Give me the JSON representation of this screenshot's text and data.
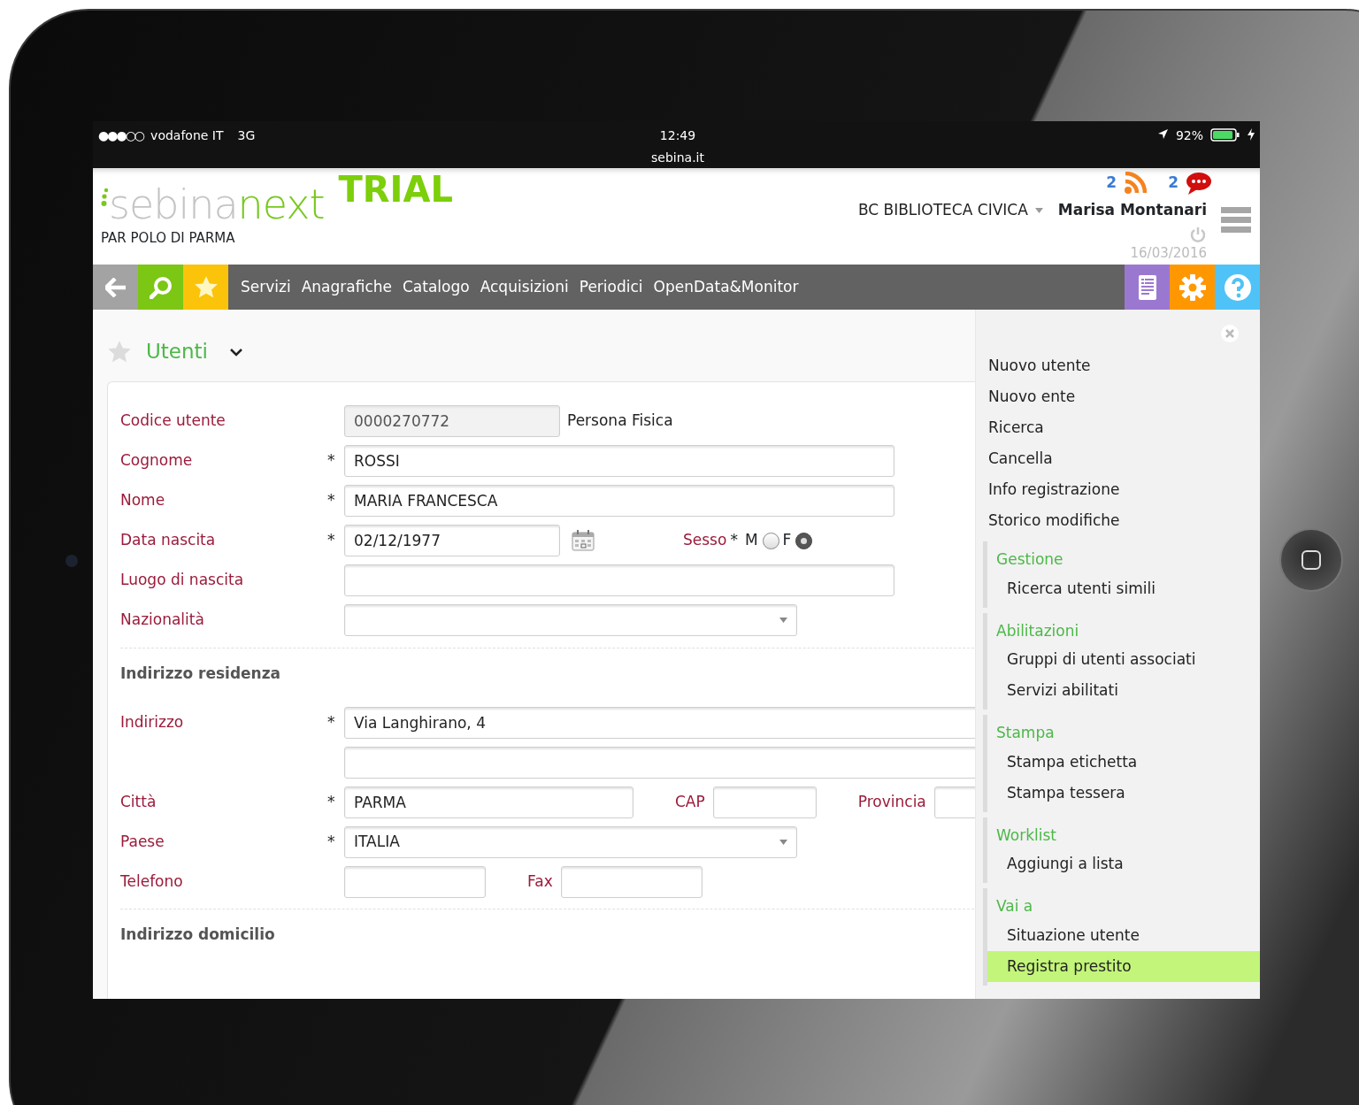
{
  "status_bar": {
    "signal": "●●●○○",
    "carrier": "vodafone IT",
    "network": "3G",
    "time": "12:49",
    "url": "sebina.it",
    "battery": "92%"
  },
  "header": {
    "logo": {
      "part_grey": "sebina",
      "part_green": "next"
    },
    "badge": "TRIAL",
    "subtitle": "PAR POLO DI PARMA",
    "feeds_count": "2",
    "messages_count": "2",
    "library": "BC BIBLIOTECA CIVICA",
    "user": "Marisa Montanari",
    "date": "16/03/2016"
  },
  "nav": {
    "items": [
      "Servizi",
      "Anagrafiche",
      "Catalogo",
      "Acquisizioni",
      "Periodici",
      "OpenData&Monitor"
    ]
  },
  "page": {
    "title": "Utenti",
    "favorite": false
  },
  "form": [
    {
      "kind": "row",
      "label": "Codice utente",
      "cells": [
        {
          "kind": "input",
          "value": "0000270772",
          "disabled": true
        },
        {
          "kind": "text",
          "text": "Persona Fisica"
        }
      ]
    },
    {
      "kind": "row",
      "label": "Cognome",
      "mark": "*",
      "cells": [
        {
          "kind": "input",
          "value": "ROSSI"
        }
      ]
    },
    {
      "kind": "row",
      "label": "Nome",
      "mark": "*",
      "cells": [
        {
          "kind": "input",
          "value": "MARIA FRANCESCA"
        }
      ]
    },
    {
      "kind": "row",
      "label": "Data nascita",
      "mark": "*",
      "cells": [
        {
          "kind": "input",
          "value": "02/12/1977"
        },
        {
          "kind": "calendar"
        },
        {
          "kind": "label",
          "text": "Sesso",
          "mark": "*"
        },
        {
          "kind": "radio",
          "text": "M",
          "selected": false
        },
        {
          "kind": "radio",
          "text": "F",
          "selected": true
        }
      ]
    },
    {
      "kind": "row",
      "label": "Luogo di nascita",
      "cells": [
        {
          "kind": "input"
        }
      ]
    },
    {
      "kind": "row",
      "label": "Nazionalità",
      "cells": [
        {
          "kind": "select"
        }
      ]
    },
    {
      "kind": "section",
      "title": "Indirizzo residenza"
    },
    {
      "kind": "row",
      "label": "Indirizzo",
      "mark": "*",
      "cells": [
        {
          "kind": "input",
          "value": "Via Langhirano, 4"
        }
      ]
    },
    {
      "kind": "row",
      "cells": [
        {
          "kind": "input"
        }
      ]
    },
    {
      "kind": "row",
      "label": "Città",
      "mark": "*",
      "cells": [
        {
          "kind": "input",
          "value": "PARMA"
        },
        {
          "kind": "label",
          "text": "CAP"
        },
        {
          "kind": "input"
        },
        {
          "kind": "label",
          "text": "Provincia"
        },
        {
          "kind": "input"
        }
      ]
    },
    {
      "kind": "row",
      "label": "Paese",
      "mark": "*",
      "cells": [
        {
          "kind": "select",
          "value": "ITALIA"
        }
      ]
    },
    {
      "kind": "row",
      "label": "Telefono",
      "cells": [
        {
          "kind": "input"
        },
        {
          "kind": "label",
          "text": "Fax"
        },
        {
          "kind": "input"
        }
      ]
    },
    {
      "kind": "section",
      "title": "Indirizzo domicilio"
    }
  ],
  "menu": [
    {
      "kind": "action",
      "label": "Nuovo utente",
      "selected": false
    },
    {
      "kind": "action",
      "label": "Nuovo ente",
      "selected": false
    },
    {
      "kind": "action",
      "label": "Ricerca",
      "selected": false
    },
    {
      "kind": "action",
      "label": "Cancella",
      "selected": false
    },
    {
      "kind": "action",
      "label": "Info registrazione",
      "selected": false
    },
    {
      "kind": "action",
      "label": "Storico modifiche",
      "selected": false
    },
    {
      "kind": "group",
      "title": "Gestione",
      "items": [
        {
          "label": "Ricerca utenti simili",
          "selected": false
        }
      ]
    },
    {
      "kind": "group",
      "title": "Abilitazioni",
      "items": [
        {
          "label": "Gruppi di utenti associati",
          "selected": false
        },
        {
          "label": "Servizi abilitati",
          "selected": false
        }
      ]
    },
    {
      "kind": "group",
      "title": "Stampa",
      "items": [
        {
          "label": "Stampa etichetta",
          "selected": false
        },
        {
          "label": "Stampa tessera",
          "selected": false
        }
      ]
    },
    {
      "kind": "group",
      "title": "Worklist",
      "items": [
        {
          "label": "Aggiungi a lista",
          "selected": false
        }
      ]
    },
    {
      "kind": "group",
      "title": "Vai a",
      "items": [
        {
          "label": "Situazione utente",
          "selected": false
        },
        {
          "label": "Registra prestito",
          "selected": true
        }
      ]
    }
  ]
}
